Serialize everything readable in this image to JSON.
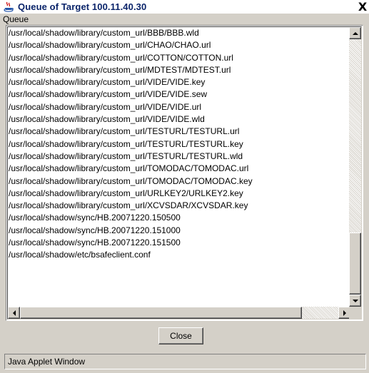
{
  "window": {
    "title": "Queue of Target 100.11.40.30",
    "icon": "java-coffee-cup-icon",
    "close_glyph": "X"
  },
  "queue_label": "Queue",
  "queue_items": [
    "/usr/local/shadow/library/custom_url/BBB/BBB.wld",
    "/usr/local/shadow/library/custom_url/CHAO/CHAO.url",
    "/usr/local/shadow/library/custom_url/COTTON/COTTON.url",
    "/usr/local/shadow/library/custom_url/MDTEST/MDTEST.url",
    "/usr/local/shadow/library/custom_url/VIDE/VIDE.key",
    "/usr/local/shadow/library/custom_url/VIDE/VIDE.sew",
    "/usr/local/shadow/library/custom_url/VIDE/VIDE.url",
    "/usr/local/shadow/library/custom_url/VIDE/VIDE.wld",
    "/usr/local/shadow/library/custom_url/TESTURL/TESTURL.url",
    "/usr/local/shadow/library/custom_url/TESTURL/TESTURL.key",
    "/usr/local/shadow/library/custom_url/TESTURL/TESTURL.wld",
    "/usr/local/shadow/library/custom_url/TOMODAC/TOMODAC.url",
    "/usr/local/shadow/library/custom_url/TOMODAC/TOMODAC.key",
    "/usr/local/shadow/library/custom_url/URLKEY2/URLKEY2.key",
    "/usr/local/shadow/library/custom_url/XCVSDAR/XCVSDAR.key",
    "/usr/local/shadow/sync/HB.20071220.150500",
    "/usr/local/shadow/sync/HB.20071220.151000",
    "/usr/local/shadow/sync/HB.20071220.151500",
    "/usr/local/shadow/etc/bsafeclient.conf"
  ],
  "buttons": {
    "close_label": "Close"
  },
  "status_text": "Java Applet Window",
  "colors": {
    "title_text": "#0a246a",
    "face": "#d4d0c8",
    "list_bg": "#ffffff"
  }
}
